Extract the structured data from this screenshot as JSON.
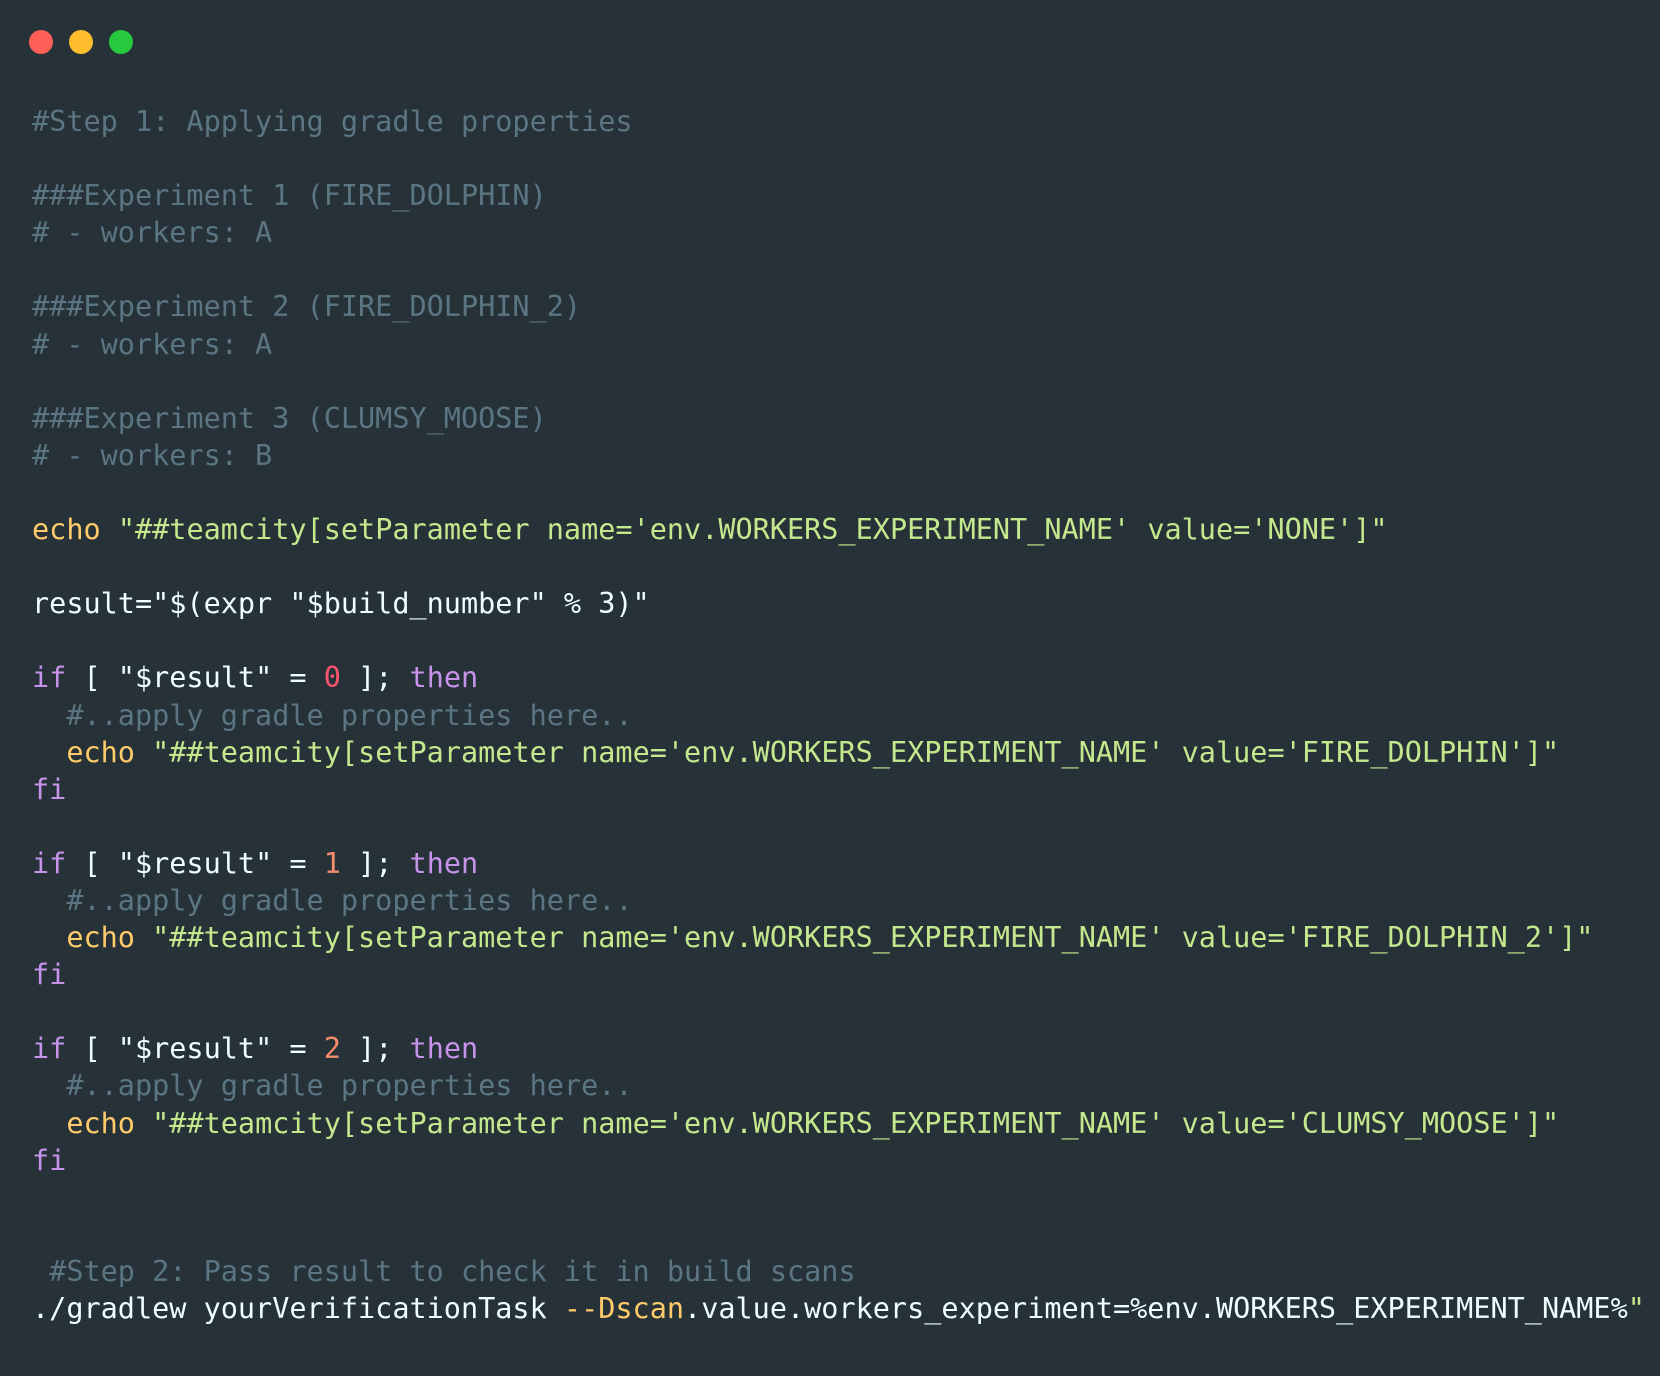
{
  "colors": {
    "background": "#263238",
    "close": "#ff5f56",
    "minimize": "#ffbd2e",
    "maximize": "#27c93f",
    "comment": "#5b7583",
    "keyword": "#c792ea",
    "builtin": "#ffcb6b",
    "string": "#c3e88d",
    "number": "#f78c6c",
    "plain": "#eeffff"
  },
  "window_controls": [
    {
      "name": "close-button",
      "color": "#ff5f56"
    },
    {
      "name": "minimize-button",
      "color": "#ffbd2e"
    },
    {
      "name": "maximize-button",
      "color": "#27c93f"
    }
  ],
  "code_lines": [
    [
      {
        "t": "c",
        "v": "#Step 1: Applying gradle properties"
      }
    ],
    [],
    [
      {
        "t": "c",
        "v": "###Experiment 1 (FIRE_DOLPHIN)"
      }
    ],
    [
      {
        "t": "c",
        "v": "# - workers: A"
      }
    ],
    [],
    [
      {
        "t": "c",
        "v": "###Experiment 2 (FIRE_DOLPHIN_2)"
      }
    ],
    [
      {
        "t": "c",
        "v": "# - workers: A"
      }
    ],
    [],
    [
      {
        "t": "c",
        "v": "###Experiment 3 (CLUMSY_MOOSE)"
      }
    ],
    [
      {
        "t": "c",
        "v": "# - workers: B"
      }
    ],
    [],
    [
      {
        "t": "b",
        "v": "echo"
      },
      {
        "t": "p",
        "v": " "
      },
      {
        "t": "s",
        "v": "\"##teamcity[setParameter name='env.WORKERS_EXPERIMENT_NAME' value='NONE']\""
      }
    ],
    [],
    [
      {
        "t": "p",
        "v": "result=\"$(expr \"$build_number\" % 3)\""
      }
    ],
    [],
    [
      {
        "t": "k",
        "v": "if"
      },
      {
        "t": "p",
        "v": " [ \"$result\" = "
      },
      {
        "t": "n0",
        "v": "0"
      },
      {
        "t": "p",
        "v": " ]; "
      },
      {
        "t": "k",
        "v": "then"
      }
    ],
    [
      {
        "t": "c",
        "v": "  #..apply gradle properties here.."
      }
    ],
    [
      {
        "t": "p",
        "v": "  "
      },
      {
        "t": "b",
        "v": "echo"
      },
      {
        "t": "p",
        "v": " "
      },
      {
        "t": "s",
        "v": "\"##teamcity[setParameter name='env.WORKERS_EXPERIMENT_NAME' value='FIRE_DOLPHIN']\""
      }
    ],
    [
      {
        "t": "k",
        "v": "fi"
      }
    ],
    [],
    [
      {
        "t": "k",
        "v": "if"
      },
      {
        "t": "p",
        "v": " [ \"$result\" = "
      },
      {
        "t": "n",
        "v": "1"
      },
      {
        "t": "p",
        "v": " ]; "
      },
      {
        "t": "k",
        "v": "then"
      }
    ],
    [
      {
        "t": "c",
        "v": "  #..apply gradle properties here.."
      }
    ],
    [
      {
        "t": "p",
        "v": "  "
      },
      {
        "t": "b",
        "v": "echo"
      },
      {
        "t": "p",
        "v": " "
      },
      {
        "t": "s",
        "v": "\"##teamcity[setParameter name='env.WORKERS_EXPERIMENT_NAME' value='FIRE_DOLPHIN_2']\""
      }
    ],
    [
      {
        "t": "k",
        "v": "fi"
      }
    ],
    [],
    [
      {
        "t": "k",
        "v": "if"
      },
      {
        "t": "p",
        "v": " [ \"$result\" = "
      },
      {
        "t": "n",
        "v": "2"
      },
      {
        "t": "p",
        "v": " ]; "
      },
      {
        "t": "k",
        "v": "then"
      }
    ],
    [
      {
        "t": "c",
        "v": "  #..apply gradle properties here.."
      }
    ],
    [
      {
        "t": "p",
        "v": "  "
      },
      {
        "t": "b",
        "v": "echo"
      },
      {
        "t": "p",
        "v": " "
      },
      {
        "t": "s",
        "v": "\"##teamcity[setParameter name='env.WORKERS_EXPERIMENT_NAME' value='CLUMSY_MOOSE']\""
      }
    ],
    [
      {
        "t": "k",
        "v": "fi"
      }
    ],
    [],
    [],
    [
      {
        "t": "c",
        "v": " #Step 2: Pass result to check it in build scans"
      }
    ],
    [
      {
        "t": "p",
        "v": "./gradlew yourVerificationTask "
      },
      {
        "t": "b",
        "v": "--Dscan"
      },
      {
        "t": "p",
        "v": ".value.workers_experiment=%env.WORKERS_EXPERIMENT_NAME%"
      },
      {
        "t": "s",
        "v": "\""
      }
    ]
  ]
}
